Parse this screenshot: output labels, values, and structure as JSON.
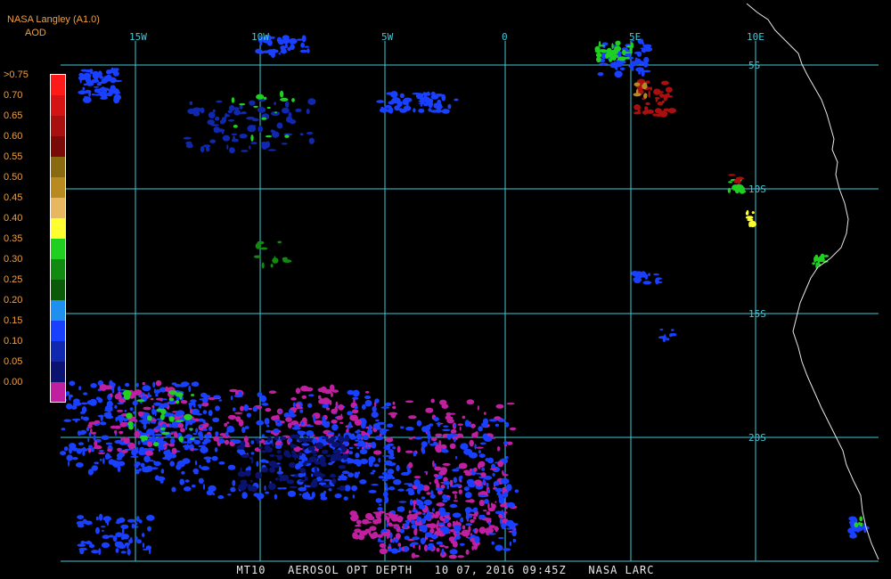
{
  "header": {
    "source": "NASA Langley (A1.0)",
    "product": "AOD"
  },
  "legend": {
    "entries": [
      {
        "label": ">0.75",
        "color": "#ff1a1a"
      },
      {
        "label": "0.70",
        "color": "#d41414"
      },
      {
        "label": "0.65",
        "color": "#a81010"
      },
      {
        "label": "0.60",
        "color": "#7a0a0a"
      },
      {
        "label": "0.55",
        "color": "#8a6a10"
      },
      {
        "label": "0.50",
        "color": "#b88a20"
      },
      {
        "label": "0.45",
        "color": "#e8b860"
      },
      {
        "label": "0.40",
        "color": "#ffff30"
      },
      {
        "label": "0.35",
        "color": "#20d020"
      },
      {
        "label": "0.30",
        "color": "#108a10"
      },
      {
        "label": "0.25",
        "color": "#0a5a0a"
      },
      {
        "label": "0.20",
        "color": "#2090f0"
      },
      {
        "label": "0.15",
        "color": "#1a40ff"
      },
      {
        "label": "0.10",
        "color": "#1028b0"
      },
      {
        "label": "0.05",
        "color": "#0a1470"
      },
      {
        "label": "0.00",
        "color": "#c020a0"
      }
    ]
  },
  "grid": {
    "color": "#40c8d8",
    "lon_labels": [
      "15W",
      "10W",
      "5W",
      "0",
      "5E",
      "10E"
    ],
    "lat_labels": [
      "5S",
      "10S",
      "15S",
      "20S"
    ]
  },
  "footer": {
    "satellite": "MT10",
    "product_name": "AEROSOL OPT DEPTH",
    "date": "10 07, 2016",
    "time": "09:45Z",
    "agency": "NASA LARC"
  }
}
